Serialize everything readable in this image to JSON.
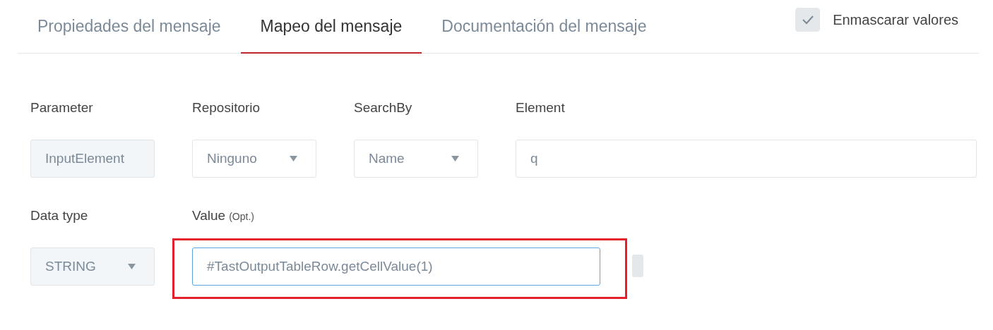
{
  "tabs": [
    {
      "label": "Propiedades del mensaje",
      "selected": false
    },
    {
      "label": "Mapeo del mensaje",
      "selected": true
    },
    {
      "label": "Documentación del mensaje",
      "selected": false
    }
  ],
  "mask_values": {
    "label": "Enmascarar valores",
    "checked": true
  },
  "rows": [
    {
      "fields": [
        {
          "label": "Parameter",
          "kind": "readonly",
          "value": "InputElement"
        },
        {
          "label": "Repositorio",
          "kind": "select",
          "value": "Ninguno"
        },
        {
          "label": "SearchBy",
          "kind": "select",
          "value": "Name"
        },
        {
          "label": "Element",
          "kind": "text",
          "value": "q",
          "focused": false,
          "annotated": false
        }
      ]
    },
    {
      "fields": [
        {
          "label": "Data type",
          "kind": "select_readonly",
          "value": "STRING"
        },
        {
          "label": "Value",
          "note": "(Opt.)",
          "kind": "text",
          "value": "#TastOutputTableRow.getCellValue(1)",
          "focused": true,
          "annotated": true
        }
      ]
    }
  ]
}
